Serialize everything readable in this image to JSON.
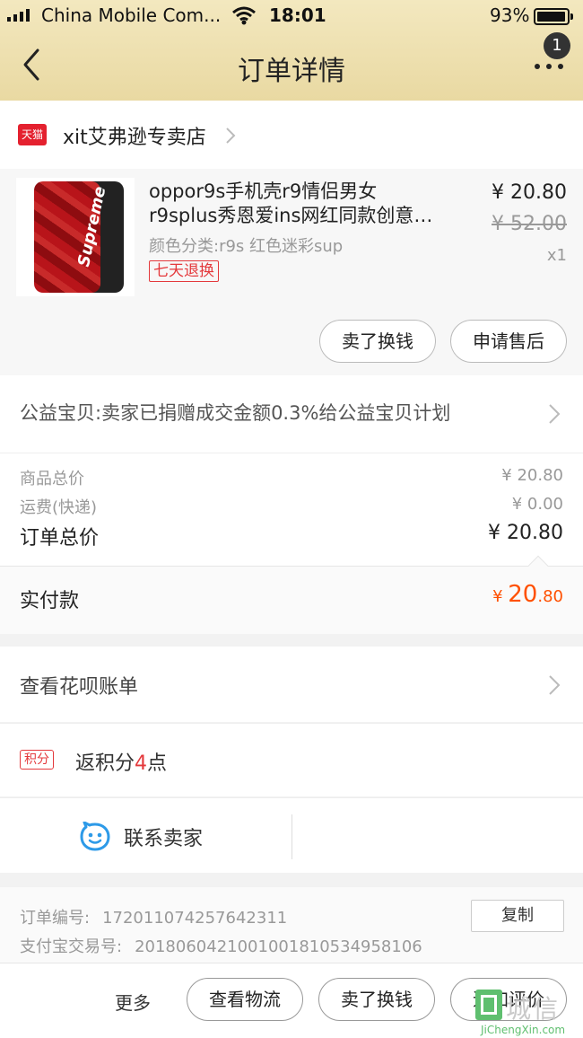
{
  "status_bar": {
    "carrier": "China Mobile Com...",
    "time": "18:01",
    "battery": "93%"
  },
  "header": {
    "title": "订单详情",
    "badge": "1"
  },
  "store": {
    "platform_tag": "天猫",
    "name": "xit艾弗逊专卖店"
  },
  "product": {
    "title_line1": "oppor9s手机壳r9情侣男女",
    "title_line2": "r9splus秀恩爱ins网红同款创意…",
    "spec": "颜色分类:r9s  红色迷彩sup",
    "tag": "七天退换",
    "price": "¥ 20.80",
    "original_price": "¥ 52.00",
    "quantity": "x1",
    "image_logo_text": "Supreme",
    "sell_button": "卖了换钱",
    "aftersale_button": "申请售后"
  },
  "charity": {
    "text": "公益宝贝:卖家已捐赠成交金额0.3%给公益宝贝计划"
  },
  "costs": {
    "goods_label": "商品总价",
    "goods_value": "¥ 20.80",
    "shipping_label": "运费(快递)",
    "shipping_value": "¥ 0.00",
    "total_label": "订单总价",
    "total_value": "¥ 20.80"
  },
  "paid": {
    "label": "实付款",
    "currency": "¥ ",
    "integer": "20",
    "decimal": ".80"
  },
  "huabei": {
    "label": "查看花呗账单"
  },
  "points": {
    "tag": "积分",
    "prefix": "返积分",
    "count": "4",
    "suffix": "点"
  },
  "contact": {
    "label": "联系卖家"
  },
  "order_info": {
    "order_no_label": "订单编号:",
    "order_no": "172011074257642311",
    "alipay_label": "支付宝交易号:",
    "alipay_no": "2018060421001001810534958106",
    "copy_button": "复制"
  },
  "bottom_bar": {
    "more": "更多",
    "logistics_button": "查看物流",
    "sell_button": "卖了换钱",
    "review_button": "追加评价"
  },
  "watermark": {
    "cn": "城信",
    "en": "JiChengXin.com"
  },
  "colors": {
    "header_gold": "#e9d9a2",
    "accent_red": "#e4393c",
    "paid_orange": "#ff5000",
    "tmall_red": "#e4212f"
  }
}
